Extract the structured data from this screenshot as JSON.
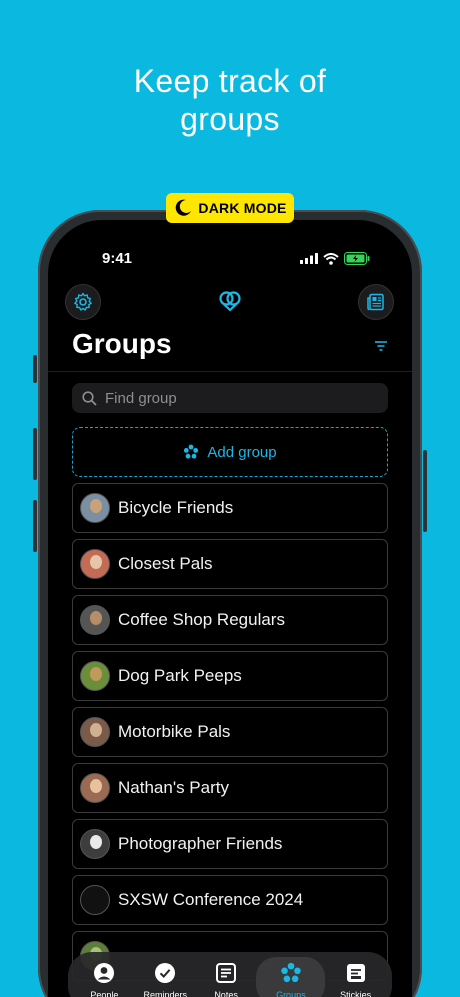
{
  "headline": {
    "line1": "Keep track of",
    "line2": "groups"
  },
  "badge": {
    "label": "DARK MODE"
  },
  "status": {
    "time": "9:41"
  },
  "page": {
    "title": "Groups"
  },
  "search": {
    "placeholder": "Find group"
  },
  "add_group": {
    "label": "Add group"
  },
  "groups": [
    {
      "name": "Bicycle Friends",
      "color": "#7b8fa3",
      "face": "#c9a27a"
    },
    {
      "name": "Closest Pals",
      "color": "#c46b55",
      "face": "#e6c6a8"
    },
    {
      "name": "Coffee Shop Regulars",
      "color": "#555555",
      "face": "#b88e6a"
    },
    {
      "name": "Dog Park Peeps",
      "color": "#6b8e3a",
      "face": "#c19a5b"
    },
    {
      "name": "Motorbike Pals",
      "color": "#7a5a48",
      "face": "#d0b090"
    },
    {
      "name": "Nathan's Party",
      "color": "#9a6a52",
      "face": "#e8c29c"
    },
    {
      "name": "Photographer Friends",
      "color": "#3d3d3d",
      "face": "#e9e9e9"
    },
    {
      "name": "SXSW Conference 2024",
      "color": "#111111",
      "face": "#111111"
    },
    {
      "name": "",
      "color": "#5d7d3a",
      "face": "#a9c07a"
    }
  ],
  "tabs": [
    {
      "label": "People",
      "icon": "person-icon"
    },
    {
      "label": "Reminders",
      "icon": "checkmark-icon"
    },
    {
      "label": "Notes",
      "icon": "notes-icon"
    },
    {
      "label": "Groups",
      "icon": "groups-icon",
      "active": true
    },
    {
      "label": "Stickies",
      "icon": "stickies-icon"
    }
  ],
  "colors": {
    "background": "#0ab8e0",
    "accent": "#1ab8e6",
    "badge": "#ffe600"
  }
}
